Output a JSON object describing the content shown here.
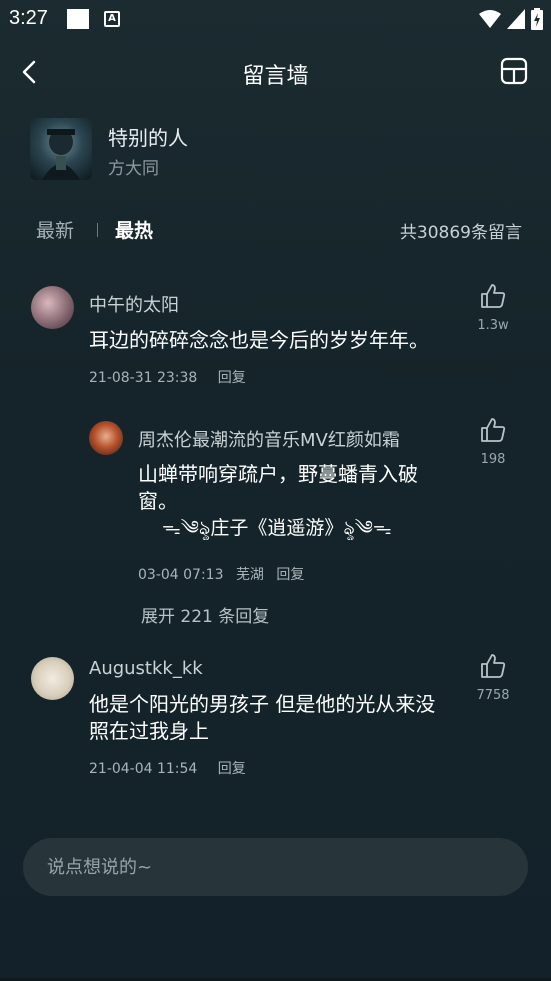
{
  "status": {
    "time": "3:27",
    "a_badge": "A"
  },
  "header": {
    "title": "留言墙"
  },
  "song": {
    "title": "特别的人",
    "artist": "方大同"
  },
  "tabs": {
    "new": "最新",
    "hot": "最热",
    "total": "共30869条留言"
  },
  "comments": [
    {
      "name": "中午的太阳",
      "text": "耳边的碎碎念念也是今后的岁岁年年。",
      "date": "21-08-31 23:38",
      "reply": "回复",
      "likes": "1.3w"
    },
    {
      "name": "周杰伦最潮流的音乐MV红颜如霜",
      "text_line1": "山蝉带响穿疏户，野蔓蟠青入破",
      "text_line2": "窗。",
      "text_line3": "ᯓ༄ৡ庄子《逍遥游》ৡ༄ᯓ",
      "date": "03-04 07:13",
      "location": "芜湖",
      "reply": "回复",
      "likes": "198"
    },
    {
      "expand": "展开 221 条回复"
    },
    {
      "name": "Augustkk_kk",
      "text_line1": "他是个阳光的男孩子 但是他的光从来没",
      "text_line2": "照在过我身上",
      "date": "21-04-04 11:54",
      "reply": "回复",
      "likes": "7758"
    }
  ],
  "input": {
    "placeholder": "说点想说的~"
  },
  "colors": {
    "background": "#15242a",
    "input_bg": "#27353a",
    "muted_text": "#a9b4b8"
  },
  "icons": [
    "back-arrow-icon",
    "layout-icon",
    "thumbs-up-icon",
    "wifi-icon",
    "signal-icon",
    "battery-icon"
  ]
}
